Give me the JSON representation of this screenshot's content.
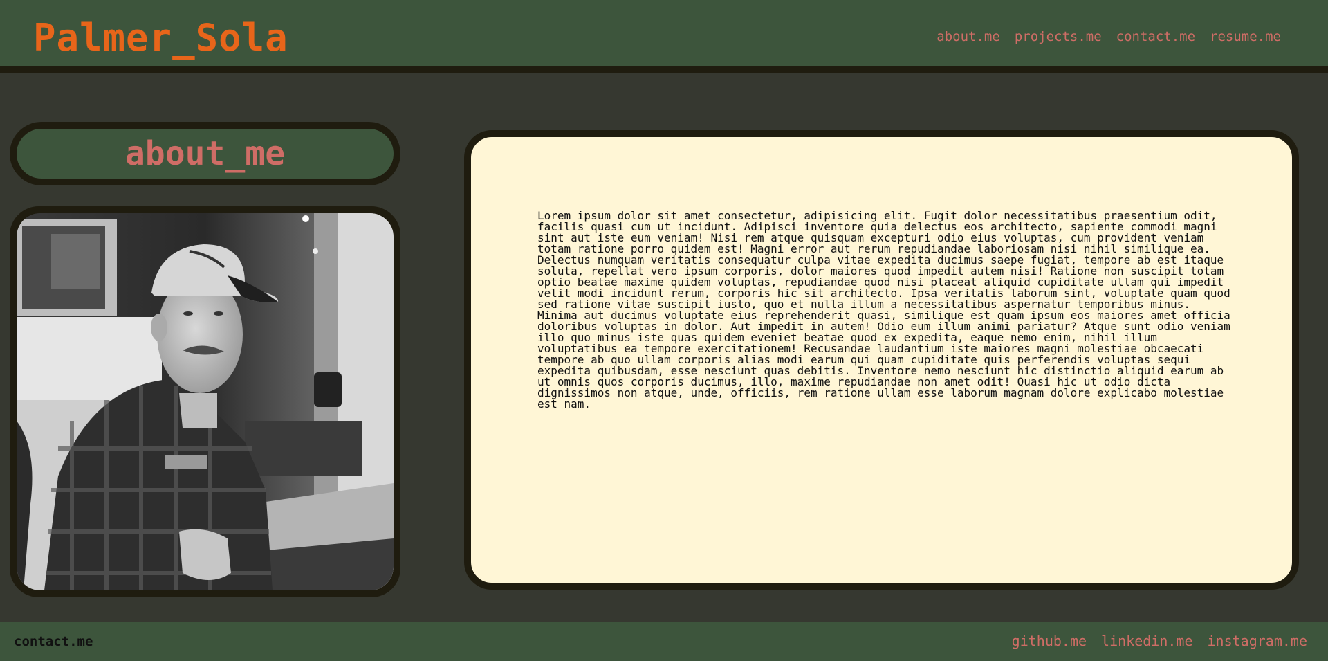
{
  "header": {
    "site_title": "Palmer_Sola",
    "nav": [
      {
        "label": "about.me"
      },
      {
        "label": "projects.me"
      },
      {
        "label": "contact.me"
      },
      {
        "label": "resume.me"
      }
    ]
  },
  "about": {
    "heading": "about_me",
    "photo_icon": "portrait-photo",
    "body": "Lorem ipsum dolor sit amet consectetur, adipisicing elit. Fugit dolor necessitatibus praesentium odit, facilis quasi cum ut incidunt. Adipisci inventore quia delectus eos architecto, sapiente commodi magni sint aut iste eum veniam! Nisi rem atque quisquam excepturi odio eius voluptas, cum provident veniam totam ratione porro quidem est! Magni error aut rerum repudiandae laboriosam nisi nihil similique ea. Delectus numquam veritatis consequatur culpa vitae expedita ducimus saepe fugiat, tempore ab est itaque soluta, repellat vero ipsum corporis, dolor maiores quod impedit autem nisi! Ratione non suscipit totam optio beatae maxime quidem voluptas, repudiandae quod nisi placeat aliquid cupiditate ullam qui impedit velit modi incidunt rerum, corporis hic sit architecto. Ipsa veritatis laborum sint, voluptate quam quod sed ratione vitae suscipit iusto, quo et nulla illum a necessitatibus aspernatur temporibus minus. Minima aut ducimus voluptate eius reprehenderit quasi, similique est quam ipsum eos maiores amet officia doloribus voluptas in dolor. Aut impedit in autem! Odio eum illum animi pariatur? Atque sunt odio veniam illo quo minus iste quas quidem eveniet beatae quod ex expedita, eaque nemo enim, nihil illum voluptatibus ea tempore exercitationem! Recusandae laudantium iste maiores magni molestiae obcaecati tempore ab quo ullam corporis alias modi earum qui quam cupiditate quis perferendis voluptas sequi expedita quibusdam, esse nesciunt quas debitis. Inventore nemo nesciunt hic distinctio aliquid earum ab ut omnis quos corporis ducimus, illo, maxime repudiandae non amet odit! Quasi hic ut odio dicta dignissimos non atque, unde, officiis, rem ratione ullam esse laborum magnam dolore explicabo molestiae est nam."
  },
  "footer": {
    "contact_label": "contact.me",
    "social": [
      {
        "label": "github.me"
      },
      {
        "label": "linkedin.me"
      },
      {
        "label": "instagram.me"
      }
    ]
  },
  "colors": {
    "header_bg": "#3d553c",
    "page_bg": "#363830",
    "border": "#1f1c0f",
    "title_orange": "#e8651a",
    "link_pink": "#cf6d66",
    "card_bg": "#fff6d6"
  }
}
